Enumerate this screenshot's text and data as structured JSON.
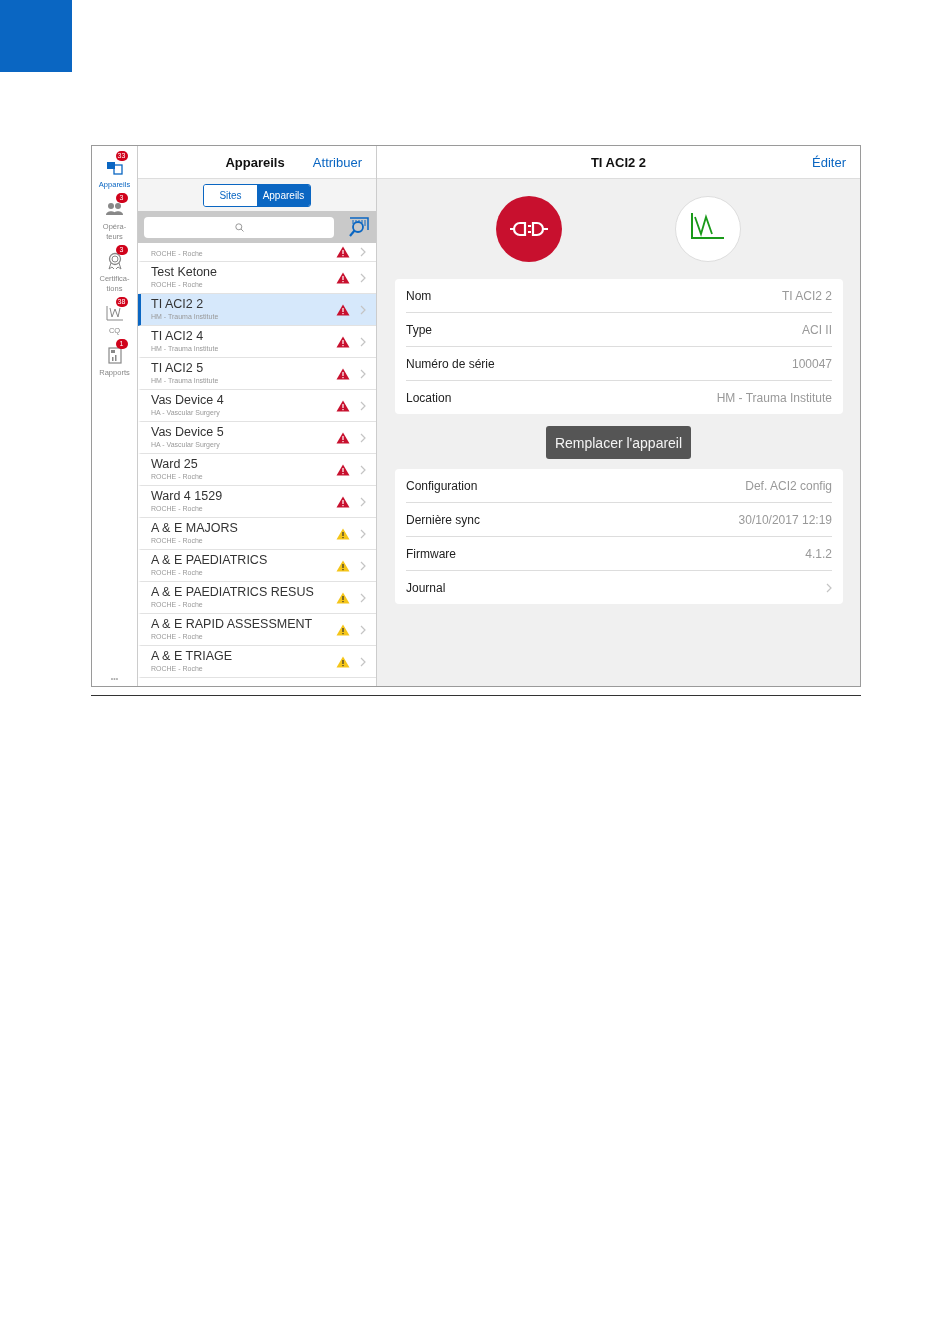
{
  "rail": {
    "items": [
      {
        "kind": "devices",
        "label": "Appareils",
        "badge": "33",
        "selected": true
      },
      {
        "kind": "operators",
        "label": "Opéra-\nteurs",
        "badge": "3",
        "selected": false
      },
      {
        "kind": "certifications",
        "label": "Certifica-\ntions",
        "badge": "3",
        "selected": false
      },
      {
        "kind": "qc",
        "label": "CQ",
        "badge": "38",
        "selected": false
      },
      {
        "kind": "reports",
        "label": "Rapports",
        "badge": "1",
        "selected": false
      }
    ],
    "more": "•••"
  },
  "list_panel": {
    "title": "Appareils",
    "action": "Attribuer",
    "segments": [
      {
        "label": "Sites",
        "selected": false
      },
      {
        "label": "Appareils",
        "selected": true
      }
    ],
    "rows": [
      {
        "subtitle": "ROCHE - Roche",
        "color": "#c8102e",
        "selected": false
      },
      {
        "title": "Test Ketone",
        "subtitle": "ROCHE - Roche",
        "color": "#c8102e",
        "selected": false
      },
      {
        "title": "TI ACI2 2",
        "subtitle": "HM - Trauma Institute",
        "color": "#c8102e",
        "selected": true
      },
      {
        "title": "TI ACI2 4",
        "subtitle": "HM - Trauma Institute",
        "color": "#c8102e",
        "selected": false
      },
      {
        "title": "TI ACI2 5",
        "subtitle": "HM - Trauma Institute",
        "color": "#c8102e",
        "selected": false
      },
      {
        "title": "Vas Device 4",
        "subtitle": "HA - Vascular Surgery",
        "color": "#c8102e",
        "selected": false
      },
      {
        "title": "Vas Device 5",
        "subtitle": "HA - Vascular Surgery",
        "color": "#c8102e",
        "selected": false
      },
      {
        "title": "Ward 25",
        "subtitle": "ROCHE - Roche",
        "color": "#c8102e",
        "selected": false
      },
      {
        "title": "Ward 4 1529",
        "subtitle": "ROCHE - Roche",
        "color": "#c8102e",
        "selected": false
      },
      {
        "title": "A & E MAJORS",
        "subtitle": "ROCHE - Roche",
        "color": "#f5c518",
        "selected": false
      },
      {
        "title": "A & E PAEDIATRICS",
        "subtitle": "ROCHE - Roche",
        "color": "#f5c518",
        "selected": false
      },
      {
        "title": "A & E PAEDIATRICS RESUS",
        "subtitle": "ROCHE - Roche",
        "color": "#f5c518",
        "selected": false
      },
      {
        "title": "A & E RAPID ASSESSMENT",
        "subtitle": "ROCHE - Roche",
        "color": "#f5c518",
        "selected": false
      },
      {
        "title": "A & E TRIAGE",
        "subtitle": "ROCHE - Roche",
        "color": "#f5c518",
        "selected": false
      }
    ]
  },
  "detail": {
    "title": "TI ACI2 2",
    "action": "Éditer",
    "info": [
      {
        "label": "Nom",
        "value": "TI ACI2 2"
      },
      {
        "label": "Type",
        "value": "ACI II"
      },
      {
        "label": "Numéro de série",
        "value": "100047"
      },
      {
        "label": "Location",
        "value": "HM - Trauma Institute"
      }
    ],
    "button": "Remplacer l'appareil",
    "status": [
      {
        "label": "Configuration",
        "value": "Def. ACI2 config",
        "kind": "value"
      },
      {
        "label": "Dernière sync",
        "value": "30/10/2017 12:19",
        "kind": "value"
      },
      {
        "label": "Firmware",
        "value": "4.1.2",
        "kind": "value"
      },
      {
        "label": "Journal",
        "kind": "link"
      }
    ]
  }
}
